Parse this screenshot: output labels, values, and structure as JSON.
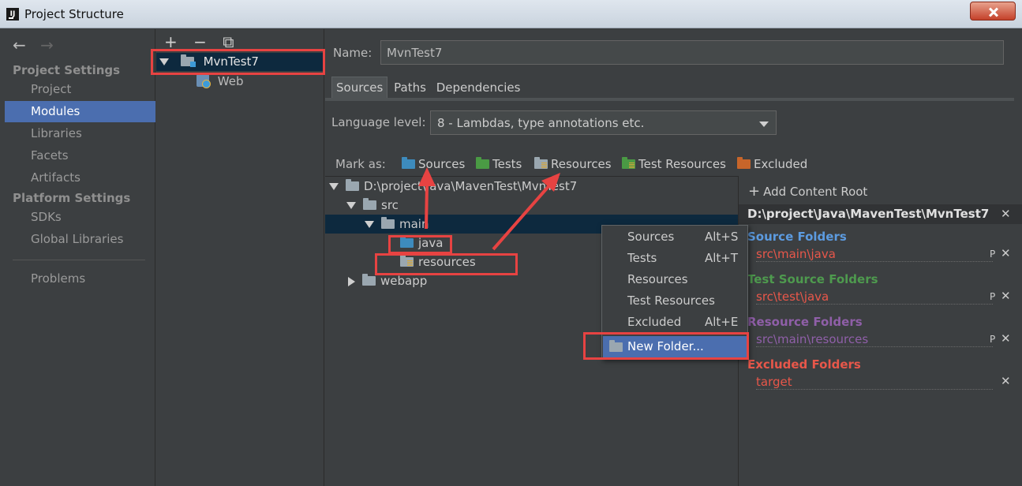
{
  "window": {
    "title": "Project Structure"
  },
  "nav": {
    "project_settings": "Project Settings",
    "platform_settings": "Platform Settings",
    "items": {
      "project": "Project",
      "modules": "Modules",
      "libraries": "Libraries",
      "facets": "Facets",
      "artifacts": "Artifacts",
      "sdks": "SDKs",
      "global_libraries": "Global Libraries",
      "problems": "Problems"
    }
  },
  "modules": {
    "toolbar": {
      "add": "+",
      "remove": "−",
      "copy": "⧉"
    },
    "root": "MvnTest7",
    "child": "Web"
  },
  "editor": {
    "name_label": "Name:",
    "name_value": "MvnTest7",
    "tabs": [
      "Sources",
      "Paths",
      "Dependencies"
    ],
    "language_label": "Language level:",
    "language_value": "8 - Lambdas, type annotations etc.",
    "mark_as": "Mark as:",
    "mark_buttons": [
      "Sources",
      "Tests",
      "Resources",
      "Test Resources",
      "Excluded"
    ]
  },
  "tree": {
    "root": "D:\\project\\Java\\MavenTest\\MvnTest7",
    "src": "src",
    "main": "main",
    "java": "java",
    "resources": "resources",
    "webapp": "webapp"
  },
  "context_menu": {
    "items": [
      {
        "label": "Sources",
        "shortcut": "Alt+S"
      },
      {
        "label": "Tests",
        "shortcut": "Alt+T"
      },
      {
        "label": "Resources",
        "shortcut": ""
      },
      {
        "label": "Test Resources",
        "shortcut": ""
      },
      {
        "label": "Excluded",
        "shortcut": "Alt+E"
      },
      {
        "label": "New Folder...",
        "shortcut": ""
      }
    ]
  },
  "content_root": {
    "add_label": "Add Content Root",
    "path": "D:\\project\\Java\\MavenTest\\MvnTest7",
    "sections": [
      {
        "title": "Source Folders",
        "path": "src\\main\\java",
        "color": "#5c9be0"
      },
      {
        "title": "Test Source Folders",
        "path": "src\\test\\java",
        "color": "#4e9a4e"
      },
      {
        "title": "Resource Folders",
        "path": "src\\main\\resources",
        "color": "#8f5fa8"
      },
      {
        "title": "Excluded Folders",
        "path": "target",
        "color": "#e8574a"
      }
    ],
    "p_icon": "P",
    "close_icon": "✕"
  },
  "colors": {
    "selection": "#4b6eaf",
    "annotation": "#e74342",
    "panel": "#3c3f41"
  }
}
